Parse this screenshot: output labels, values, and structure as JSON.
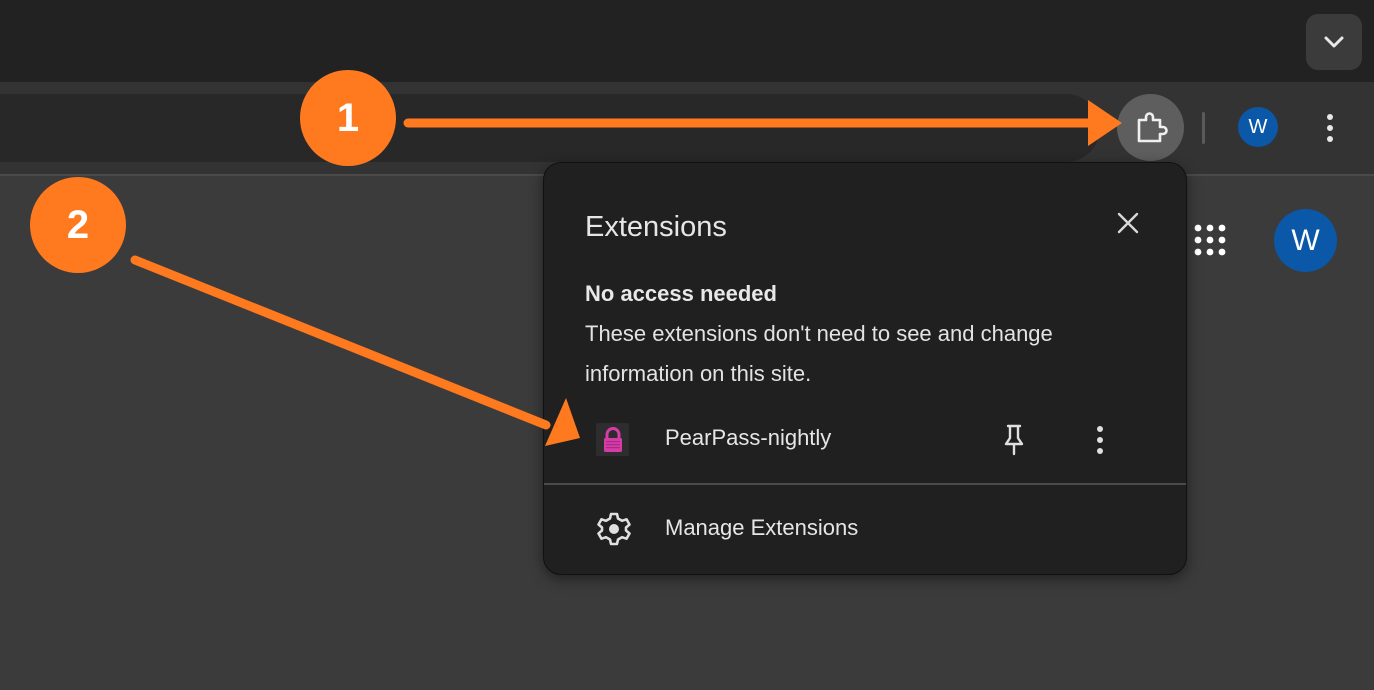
{
  "colors": {
    "annotation_orange": "#ff7a1f",
    "profile_blue": "#0b57a8",
    "pearpass_pink": "#d63ba8"
  },
  "toolbar": {
    "profile_initial": "W",
    "extensions_icon": "puzzle-icon",
    "menu_icon": "vertical-dots-icon"
  },
  "page": {
    "apps_icon": "apps-grid-icon",
    "profile_initial": "W"
  },
  "popup": {
    "title": "Extensions",
    "close_icon": "close-icon",
    "section_title": "No access needed",
    "section_description": "These extensions don't need to see and change information on this site.",
    "extensions": [
      {
        "name": "PearPass-nightly",
        "icon": "lock-icon"
      }
    ],
    "manage_label": "Manage Extensions"
  },
  "annotations": {
    "step_1": "1",
    "step_2": "2"
  }
}
